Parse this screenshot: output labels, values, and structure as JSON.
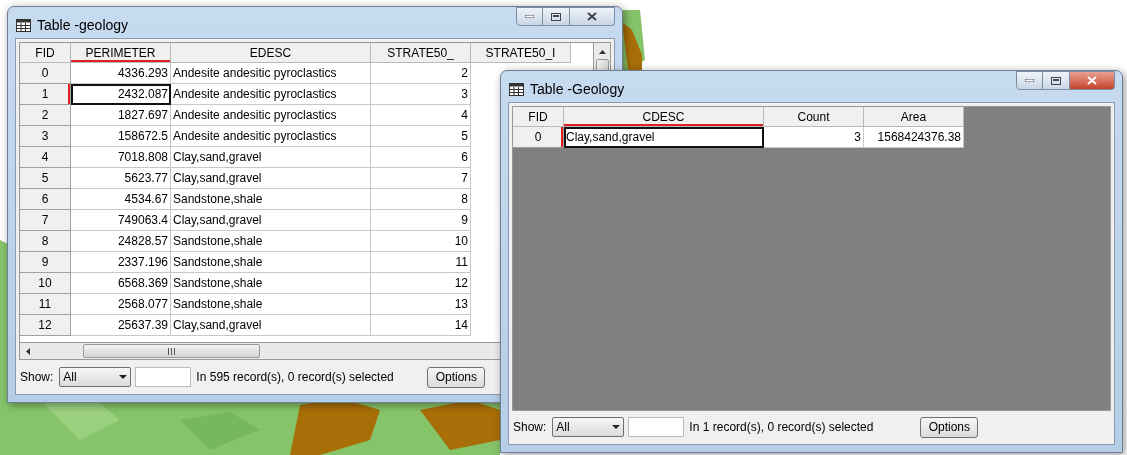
{
  "windows": [
    {
      "title": "Table -geology",
      "active": false,
      "columns": [
        {
          "label": "FID",
          "kind": "id",
          "active": false
        },
        {
          "label": "PERIMETER",
          "kind": "number",
          "active": true
        },
        {
          "label": "EDESC",
          "kind": "text",
          "active": false
        },
        {
          "label": "STRATE50_",
          "kind": "number",
          "active": false
        },
        {
          "label": "STRATE50_I",
          "kind": "number",
          "active": false
        }
      ],
      "rows": [
        {
          "current": false,
          "cells": [
            "0",
            "4336.293",
            "Andesite andesitic pyroclastics",
            "2"
          ]
        },
        {
          "current": true,
          "cells": [
            "1",
            "2432.087",
            "Andesite andesitic pyroclastics",
            "3"
          ]
        },
        {
          "current": false,
          "cells": [
            "2",
            "1827.697",
            "Andesite andesitic pyroclastics",
            "4"
          ]
        },
        {
          "current": false,
          "cells": [
            "3",
            "158672.5",
            "Andesite andesitic pyroclastics",
            "5"
          ]
        },
        {
          "current": false,
          "cells": [
            "4",
            "7018.808",
            "Clay,sand,gravel",
            "6"
          ]
        },
        {
          "current": false,
          "cells": [
            "5",
            "5623.77",
            "Clay,sand,gravel",
            "7"
          ]
        },
        {
          "current": false,
          "cells": [
            "6",
            "4534.67",
            "Sandstone,shale",
            "8"
          ]
        },
        {
          "current": false,
          "cells": [
            "7",
            "749063.4",
            "Clay,sand,gravel",
            "9"
          ]
        },
        {
          "current": false,
          "cells": [
            "8",
            "24828.57",
            "Sandstone,shale",
            "10"
          ]
        },
        {
          "current": false,
          "cells": [
            "9",
            "2337.196",
            "Sandstone,shale",
            "11"
          ]
        },
        {
          "current": false,
          "cells": [
            "10",
            "6568.369",
            "Sandstone,shale",
            "12"
          ]
        },
        {
          "current": false,
          "cells": [
            "11",
            "2568.077",
            "Sandstone,shale",
            "13"
          ]
        },
        {
          "current": false,
          "cells": [
            "12",
            "25637.39",
            "Clay,sand,gravel",
            "14"
          ]
        }
      ],
      "footer": {
        "show_label": "Show:",
        "show_value": "All",
        "status": "In 595 record(s), 0 record(s) selected",
        "options": "Options"
      }
    },
    {
      "title": "Table -Geology",
      "active": true,
      "columns": [
        {
          "label": "FID",
          "kind": "id",
          "active": false
        },
        {
          "label": "CDESC",
          "kind": "text",
          "active": true
        },
        {
          "label": "Count",
          "kind": "number",
          "active": false
        },
        {
          "label": "Area",
          "kind": "number",
          "active": false
        }
      ],
      "rows": [
        {
          "current": true,
          "cells": [
            "0",
            "Clay,sand,gravel",
            "3",
            "1568424376.38"
          ]
        }
      ],
      "footer": {
        "show_label": "Show:",
        "show_value": "All",
        "status": "In 1 record(s), 0 record(s) selected",
        "options": "Options"
      }
    }
  ]
}
